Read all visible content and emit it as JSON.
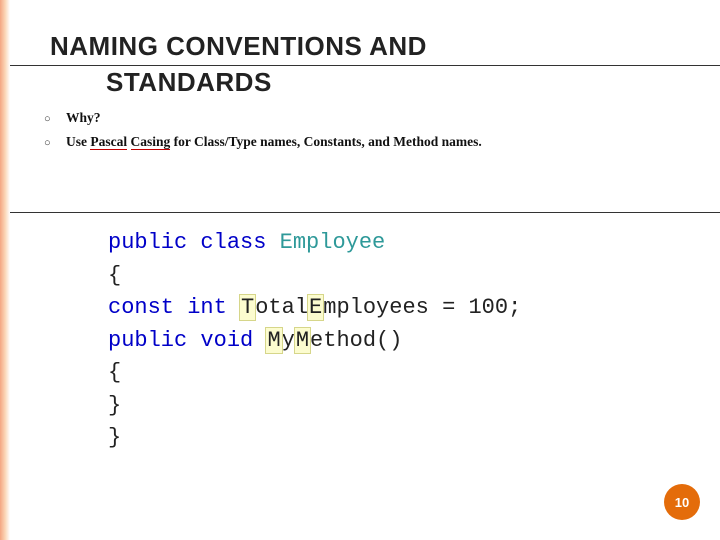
{
  "title_line1": "NAMING CONVENTIONS AND",
  "title_line2": "STANDARDS",
  "bullets": {
    "b1": "Why?",
    "b2_prefix": "Use ",
    "b2_underlined1": "Pascal",
    "b2_space": " ",
    "b2_underlined2": "Casing",
    "b2_suffix": " for Class/Type names, Constants, and Method names."
  },
  "code": {
    "kw_public": "public",
    "kw_class": "class",
    "type_employee": "Employee",
    "brace_open": "{",
    "kw_const": "const",
    "kw_int": "int",
    "const_name_hl1": "T",
    "const_name_mid": "otal",
    "const_name_hl2": "E",
    "const_name_end": "mployees",
    "const_assign": " = 100;",
    "kw_void": "void",
    "method_hl1": "M",
    "method_mid": "y",
    "method_hl2": "M",
    "method_end": "ethod()",
    "brace_close": "}"
  },
  "slide_number": "10"
}
